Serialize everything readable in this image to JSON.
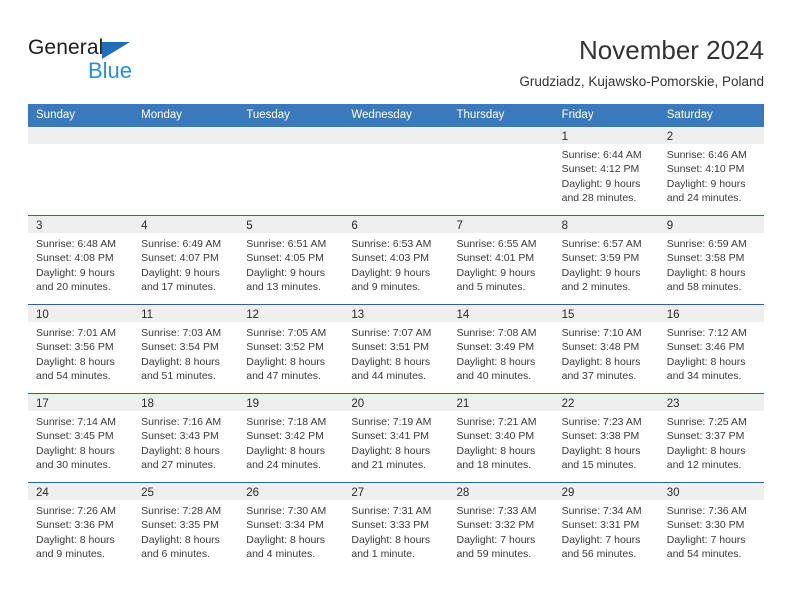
{
  "brand": {
    "name_top": "General",
    "name_bottom": "Blue",
    "triangle_color": "#1c6fba",
    "blue_color": "#2a8fd4"
  },
  "header": {
    "title": "November 2024",
    "subtitle": "Grudziadz, Kujawsko-Pomorskie, Poland"
  },
  "theme": {
    "header_blue": "#3b79bd",
    "row_divider": "#2f6398",
    "day_band": "#efefef",
    "text": "#3a3a3a"
  },
  "weekdays": [
    "Sunday",
    "Monday",
    "Tuesday",
    "Wednesday",
    "Thursday",
    "Friday",
    "Saturday"
  ],
  "weeks": [
    [
      {
        "day": "",
        "lines": []
      },
      {
        "day": "",
        "lines": []
      },
      {
        "day": "",
        "lines": []
      },
      {
        "day": "",
        "lines": []
      },
      {
        "day": "",
        "lines": []
      },
      {
        "day": "1",
        "lines": [
          "Sunrise: 6:44 AM",
          "Sunset: 4:12 PM",
          "Daylight: 9 hours",
          "and 28 minutes."
        ]
      },
      {
        "day": "2",
        "lines": [
          "Sunrise: 6:46 AM",
          "Sunset: 4:10 PM",
          "Daylight: 9 hours",
          "and 24 minutes."
        ]
      }
    ],
    [
      {
        "day": "3",
        "lines": [
          "Sunrise: 6:48 AM",
          "Sunset: 4:08 PM",
          "Daylight: 9 hours",
          "and 20 minutes."
        ]
      },
      {
        "day": "4",
        "lines": [
          "Sunrise: 6:49 AM",
          "Sunset: 4:07 PM",
          "Daylight: 9 hours",
          "and 17 minutes."
        ]
      },
      {
        "day": "5",
        "lines": [
          "Sunrise: 6:51 AM",
          "Sunset: 4:05 PM",
          "Daylight: 9 hours",
          "and 13 minutes."
        ]
      },
      {
        "day": "6",
        "lines": [
          "Sunrise: 6:53 AM",
          "Sunset: 4:03 PM",
          "Daylight: 9 hours",
          "and 9 minutes."
        ]
      },
      {
        "day": "7",
        "lines": [
          "Sunrise: 6:55 AM",
          "Sunset: 4:01 PM",
          "Daylight: 9 hours",
          "and 5 minutes."
        ]
      },
      {
        "day": "8",
        "lines": [
          "Sunrise: 6:57 AM",
          "Sunset: 3:59 PM",
          "Daylight: 9 hours",
          "and 2 minutes."
        ]
      },
      {
        "day": "9",
        "lines": [
          "Sunrise: 6:59 AM",
          "Sunset: 3:58 PM",
          "Daylight: 8 hours",
          "and 58 minutes."
        ]
      }
    ],
    [
      {
        "day": "10",
        "lines": [
          "Sunrise: 7:01 AM",
          "Sunset: 3:56 PM",
          "Daylight: 8 hours",
          "and 54 minutes."
        ]
      },
      {
        "day": "11",
        "lines": [
          "Sunrise: 7:03 AM",
          "Sunset: 3:54 PM",
          "Daylight: 8 hours",
          "and 51 minutes."
        ]
      },
      {
        "day": "12",
        "lines": [
          "Sunrise: 7:05 AM",
          "Sunset: 3:52 PM",
          "Daylight: 8 hours",
          "and 47 minutes."
        ]
      },
      {
        "day": "13",
        "lines": [
          "Sunrise: 7:07 AM",
          "Sunset: 3:51 PM",
          "Daylight: 8 hours",
          "and 44 minutes."
        ]
      },
      {
        "day": "14",
        "lines": [
          "Sunrise: 7:08 AM",
          "Sunset: 3:49 PM",
          "Daylight: 8 hours",
          "and 40 minutes."
        ]
      },
      {
        "day": "15",
        "lines": [
          "Sunrise: 7:10 AM",
          "Sunset: 3:48 PM",
          "Daylight: 8 hours",
          "and 37 minutes."
        ]
      },
      {
        "day": "16",
        "lines": [
          "Sunrise: 7:12 AM",
          "Sunset: 3:46 PM",
          "Daylight: 8 hours",
          "and 34 minutes."
        ]
      }
    ],
    [
      {
        "day": "17",
        "lines": [
          "Sunrise: 7:14 AM",
          "Sunset: 3:45 PM",
          "Daylight: 8 hours",
          "and 30 minutes."
        ]
      },
      {
        "day": "18",
        "lines": [
          "Sunrise: 7:16 AM",
          "Sunset: 3:43 PM",
          "Daylight: 8 hours",
          "and 27 minutes."
        ]
      },
      {
        "day": "19",
        "lines": [
          "Sunrise: 7:18 AM",
          "Sunset: 3:42 PM",
          "Daylight: 8 hours",
          "and 24 minutes."
        ]
      },
      {
        "day": "20",
        "lines": [
          "Sunrise: 7:19 AM",
          "Sunset: 3:41 PM",
          "Daylight: 8 hours",
          "and 21 minutes."
        ]
      },
      {
        "day": "21",
        "lines": [
          "Sunrise: 7:21 AM",
          "Sunset: 3:40 PM",
          "Daylight: 8 hours",
          "and 18 minutes."
        ]
      },
      {
        "day": "22",
        "lines": [
          "Sunrise: 7:23 AM",
          "Sunset: 3:38 PM",
          "Daylight: 8 hours",
          "and 15 minutes."
        ]
      },
      {
        "day": "23",
        "lines": [
          "Sunrise: 7:25 AM",
          "Sunset: 3:37 PM",
          "Daylight: 8 hours",
          "and 12 minutes."
        ]
      }
    ],
    [
      {
        "day": "24",
        "lines": [
          "Sunrise: 7:26 AM",
          "Sunset: 3:36 PM",
          "Daylight: 8 hours",
          "and 9 minutes."
        ]
      },
      {
        "day": "25",
        "lines": [
          "Sunrise: 7:28 AM",
          "Sunset: 3:35 PM",
          "Daylight: 8 hours",
          "and 6 minutes."
        ]
      },
      {
        "day": "26",
        "lines": [
          "Sunrise: 7:30 AM",
          "Sunset: 3:34 PM",
          "Daylight: 8 hours",
          "and 4 minutes."
        ]
      },
      {
        "day": "27",
        "lines": [
          "Sunrise: 7:31 AM",
          "Sunset: 3:33 PM",
          "Daylight: 8 hours",
          "and 1 minute."
        ]
      },
      {
        "day": "28",
        "lines": [
          "Sunrise: 7:33 AM",
          "Sunset: 3:32 PM",
          "Daylight: 7 hours",
          "and 59 minutes."
        ]
      },
      {
        "day": "29",
        "lines": [
          "Sunrise: 7:34 AM",
          "Sunset: 3:31 PM",
          "Daylight: 7 hours",
          "and 56 minutes."
        ]
      },
      {
        "day": "30",
        "lines": [
          "Sunrise: 7:36 AM",
          "Sunset: 3:30 PM",
          "Daylight: 7 hours",
          "and 54 minutes."
        ]
      }
    ]
  ]
}
